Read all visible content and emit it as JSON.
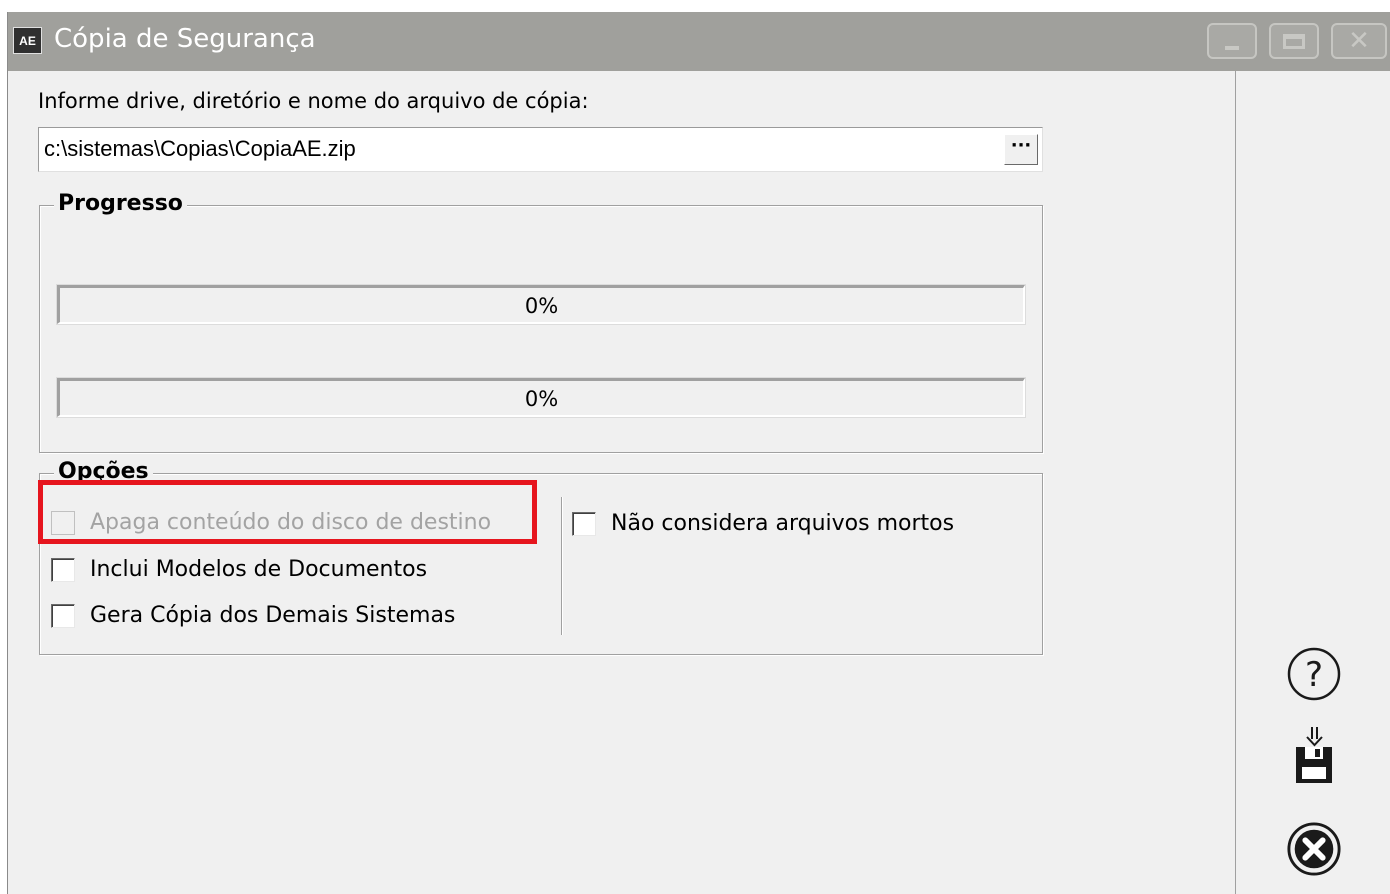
{
  "window": {
    "app_icon_text": "AE",
    "title": "Cópia de Segurança",
    "controls": {
      "minimize": "minimize",
      "maximize": "maximize",
      "close": "close"
    }
  },
  "path": {
    "label": "Informe drive, diretório e nome do arquivo de cópia:",
    "value": "c:\\sistemas\\Copias\\CopiaAE.zip",
    "browse_label": "···"
  },
  "progress": {
    "title": "Progresso",
    "bars": [
      {
        "text": "0%",
        "fraction": 0
      },
      {
        "text": "0%",
        "fraction": 0
      }
    ]
  },
  "options": {
    "title": "Opções",
    "left": [
      {
        "label": "Apaga conteúdo do disco de destino",
        "checked": false,
        "enabled": false
      },
      {
        "label": "Inclui Modelos de Documentos",
        "checked": false,
        "enabled": true
      },
      {
        "label": "Gera Cópia dos Demais Sistemas",
        "checked": false,
        "enabled": true
      }
    ],
    "right": [
      {
        "label": "Não considera arquivos mortos",
        "checked": false,
        "enabled": true
      }
    ]
  },
  "side_icons": [
    "help-icon",
    "save-backup-icon",
    "cancel-icon"
  ],
  "colors": {
    "titlebar": "#a0a09c",
    "highlight": "#e6151e",
    "panel": "#f0f0f0"
  }
}
